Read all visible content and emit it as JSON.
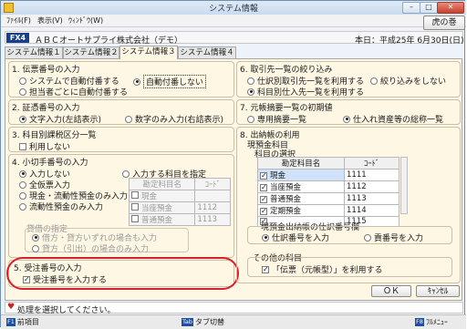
{
  "window": {
    "title": "システム情報",
    "return_button": "虎の巻"
  },
  "menu": [
    "ﾌｧｲﾙ(F)",
    "表示(V)",
    "ｳｨﾝﾄﾞｳ(W)"
  ],
  "header": {
    "badge": "FX4",
    "company": "ＡＢＣオートサプライ株式会社（デモ）",
    "date": "本日：平成25年 6月30日(日)"
  },
  "tabs": [
    "システム情報１",
    "システム情報２",
    "システム情報３",
    "システム情報４"
  ],
  "left": {
    "s1": {
      "title": "1. 伝票番号の入力",
      "opt1": "システムで自動付番する",
      "opt2": "自動付番しない",
      "opt3": "担当者ごとに自動付番する"
    },
    "s2": {
      "title": "2. 証憑番号の入力",
      "opt1": "文字入力(左詰表示)",
      "opt2": "数字のみ入力(右詰表示)"
    },
    "s3": {
      "title": "3. 科目別課税区分一覧",
      "opt1": "利用しない"
    },
    "s4": {
      "title": "4. 小切手番号の入力",
      "opt1": "入力しない",
      "opt2": "入力する科目を指定",
      "opt3": "全仮票入力",
      "opt4": "現金・流動性預金のみ入力",
      "opt5": "流動性預金のみ入力",
      "col1": "勘定科目名",
      "col2": "ｺｰﾄﾞ",
      "rows": [
        {
          "name": "現金",
          "code": ""
        },
        {
          "name": "当座預金",
          "code": "1112"
        },
        {
          "name": "普通預金",
          "code": "1113"
        }
      ],
      "sub_title": "貸借の指定",
      "sub1": "借方・貸方いずれの場合も入力",
      "sub2": "貸方（引出）の場合のみ入力"
    },
    "s5": {
      "title": "5. 受注番号の入力",
      "opt1": "受注番号を入力する"
    }
  },
  "right": {
    "s6": {
      "title": "6. 取引先一覧の絞り込み",
      "opt1": "仕訳別取引先一覧を利用する",
      "opt2": "絞り込みをしない",
      "opt3": "科目別仕入先一覧を利用する"
    },
    "s7": {
      "title": "7. 元帳摘要一覧の初期値",
      "opt1": "専用摘要一覧",
      "opt2": "仕入れ資産等の総称一覧"
    },
    "s8": {
      "title": "8. 出納帳の利用",
      "sub1": "現預金科目",
      "sub2": "科目の選択",
      "col1": "勘定科目名",
      "col2": "ｺｰﾄﾞ",
      "rows": [
        {
          "checked": true,
          "name": "現金",
          "code": "1111"
        },
        {
          "checked": true,
          "name": "当座預金",
          "code": "1112"
        },
        {
          "checked": true,
          "name": "普通預金",
          "code": "1113"
        },
        {
          "checked": true,
          "name": "定期預金",
          "code": "1114"
        },
        {
          "checked": true,
          "name": "",
          "code": "1115"
        }
      ],
      "slip_title": "現預金出納帳の仕訳番号欄",
      "slip1": "仕訳番号を入力",
      "slip2": "貢番号を入力",
      "other_title": "その他の科目",
      "other_opt": "「伝票（元帳型）」を利用する"
    }
  },
  "buttons": {
    "ok": "ＯＫ",
    "cancel": "ｷｬﾝｾﾙ"
  },
  "status": "処理を選択してください。",
  "fkeys": {
    "f1": "F1",
    "f1_label": "前項目",
    "tab_key": "Tab",
    "tab_label": "タブ切替",
    "f8": "F8",
    "f8_label": "ﾌﾙﾒﾆｭｰ"
  }
}
